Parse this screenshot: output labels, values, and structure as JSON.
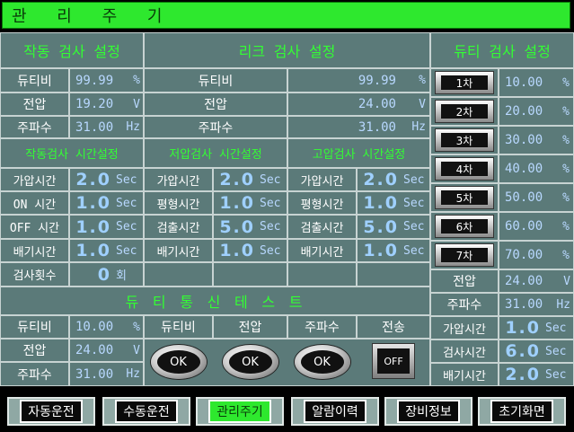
{
  "title": "관 리 주 기",
  "headers": {
    "action_test": "작동 검사 설정",
    "leak_test": "리크 검사 설정",
    "duty_test": "듀티 검사 설정"
  },
  "action_settings": [
    {
      "label": "듀티비",
      "value": "99.99",
      "unit": "%"
    },
    {
      "label": "전압",
      "value": "19.20",
      "unit": "V"
    },
    {
      "label": "주파수",
      "value": "31.00",
      "unit": "Hz"
    }
  ],
  "leak_settings": [
    {
      "label": "듀티비",
      "value": "99.99",
      "unit": "%"
    },
    {
      "label": "전압",
      "value": "24.00",
      "unit": "V"
    },
    {
      "label": "주파수",
      "value": "31.00",
      "unit": "Hz"
    }
  ],
  "time_headers": {
    "action": "작동검사 시간설정",
    "low": "저압검사 시간설정",
    "high": "고압검사 시간설정"
  },
  "action_time": [
    {
      "label": "가압시간",
      "value": "2.0",
      "unit": "Sec"
    },
    {
      "label": "ON 시간",
      "value": "1.0",
      "unit": "Sec"
    },
    {
      "label": "OFF 시간",
      "value": "1.0",
      "unit": "Sec"
    },
    {
      "label": "배기시간",
      "value": "1.0",
      "unit": "Sec"
    },
    {
      "label": "검사횟수",
      "value": "0",
      "unit": "회"
    }
  ],
  "low_time": [
    {
      "label": "가압시간",
      "value": "2.0",
      "unit": "Sec"
    },
    {
      "label": "평형시간",
      "value": "1.0",
      "unit": "Sec"
    },
    {
      "label": "검출시간",
      "value": "5.0",
      "unit": "Sec"
    },
    {
      "label": "배기시간",
      "value": "1.0",
      "unit": "Sec"
    }
  ],
  "high_time": [
    {
      "label": "가압시간",
      "value": "2.0",
      "unit": "Sec"
    },
    {
      "label": "평형시간",
      "value": "1.0",
      "unit": "Sec"
    },
    {
      "label": "검출시간",
      "value": "5.0",
      "unit": "Sec"
    },
    {
      "label": "배기시간",
      "value": "1.0",
      "unit": "Sec"
    }
  ],
  "duty_steps": [
    {
      "label": "1차",
      "value": "10.00",
      "unit": "%"
    },
    {
      "label": "2차",
      "value": "20.00",
      "unit": "%"
    },
    {
      "label": "3차",
      "value": "30.00",
      "unit": "%"
    },
    {
      "label": "4차",
      "value": "40.00",
      "unit": "%"
    },
    {
      "label": "5차",
      "value": "50.00",
      "unit": "%"
    },
    {
      "label": "6차",
      "value": "60.00",
      "unit": "%"
    },
    {
      "label": "7차",
      "value": "70.00",
      "unit": "%"
    }
  ],
  "duty_right_settings": [
    {
      "label": "전압",
      "value": "24.00",
      "unit": "V"
    },
    {
      "label": "주파수",
      "value": "31.00",
      "unit": "Hz"
    }
  ],
  "duty_right_times": [
    {
      "label": "가압시간",
      "value": "1.0",
      "unit": "Sec"
    },
    {
      "label": "검사시간",
      "value": "6.0",
      "unit": "Sec"
    },
    {
      "label": "배기시간",
      "value": "2.0",
      "unit": "Sec"
    }
  ],
  "comm_test": {
    "title": "듀 티  통 신  테 스 트",
    "rows": [
      {
        "label": "듀티비",
        "value": "10.00",
        "unit": "%"
      },
      {
        "label": "전압",
        "value": "24.00",
        "unit": "V"
      },
      {
        "label": "주파수",
        "value": "31.00",
        "unit": "Hz"
      }
    ],
    "col_headers": [
      "듀티비",
      "전압",
      "주파수",
      "전송"
    ],
    "buttons": [
      "OK",
      "OK",
      "OK",
      "OFF"
    ]
  },
  "nav": [
    {
      "label": "자동운전",
      "active": false
    },
    {
      "label": "수동운전",
      "active": false
    },
    {
      "label": "관리주기",
      "active": true
    },
    {
      "label": "알람이력",
      "active": false
    },
    {
      "label": "장비정보",
      "active": false
    },
    {
      "label": "초기화면",
      "active": false
    }
  ]
}
